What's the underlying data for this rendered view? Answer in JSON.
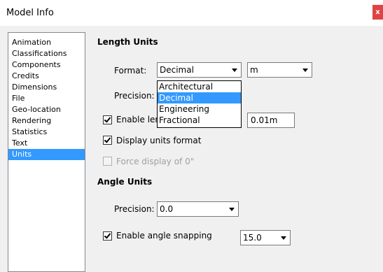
{
  "window": {
    "title": "Model Info",
    "close_label": "x"
  },
  "sidebar": {
    "items": [
      {
        "label": "Animation",
        "selected": false
      },
      {
        "label": "Classifications",
        "selected": false
      },
      {
        "label": "Components",
        "selected": false
      },
      {
        "label": "Credits",
        "selected": false
      },
      {
        "label": "Dimensions",
        "selected": false
      },
      {
        "label": "File",
        "selected": false
      },
      {
        "label": "Geo-location",
        "selected": false
      },
      {
        "label": "Rendering",
        "selected": false
      },
      {
        "label": "Statistics",
        "selected": false
      },
      {
        "label": "Text",
        "selected": false
      },
      {
        "label": "Units",
        "selected": true
      }
    ]
  },
  "length_units": {
    "heading": "Length Units",
    "format_label": "Format:",
    "format_value": "Decimal",
    "unit_value": "m",
    "precision_label": "Precision:",
    "format_options": [
      "Architectural",
      "Decimal",
      "Engineering",
      "Fractional"
    ],
    "format_selected_index": 1,
    "enable_snapping_label": "Enable len",
    "enable_snapping_checked": true,
    "snapping_value": "0.01m",
    "display_units_label": "Display units format",
    "display_units_checked": true,
    "force_display_label": "Force display of 0\"",
    "force_display_checked": false
  },
  "angle_units": {
    "heading": "Angle Units",
    "precision_label": "Precision:",
    "precision_value": "0.0",
    "enable_snapping_label": "Enable angle snapping",
    "enable_snapping_checked": true,
    "snapping_value": "15.0"
  },
  "colors": {
    "selection": "#3399ff",
    "close_button": "#e04343"
  }
}
